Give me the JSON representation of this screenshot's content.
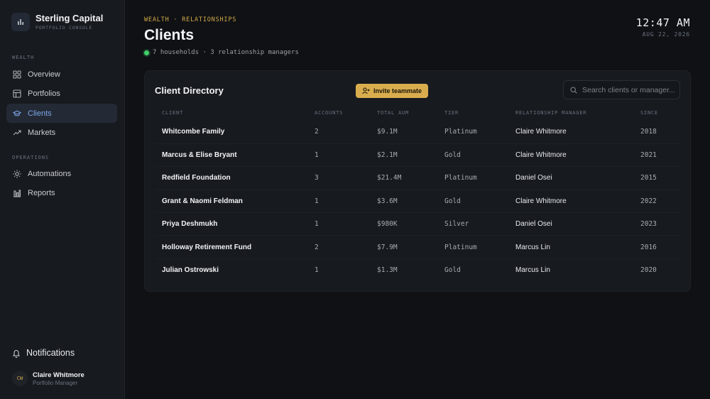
{
  "brand": {
    "name": "Sterling Capital",
    "subtitle": "PORTFOLIO CONSOLE"
  },
  "sidebar": {
    "sections": [
      {
        "label": "WEALTH",
        "items": [
          {
            "label": "Overview",
            "icon": "grid-icon"
          },
          {
            "label": "Portfolios",
            "icon": "table-icon"
          },
          {
            "label": "Clients",
            "icon": "graduation-cap-icon",
            "active": true
          },
          {
            "label": "Markets",
            "icon": "trending-up-icon"
          }
        ]
      },
      {
        "label": "OPERATIONS",
        "items": [
          {
            "label": "Automations",
            "icon": "sun-icon"
          },
          {
            "label": "Reports",
            "icon": "bar-chart-icon"
          }
        ]
      }
    ],
    "notifications_label": "Notifications",
    "user": {
      "initials": "CW",
      "name": "Claire Whitmore",
      "role": "Portfolio Manager"
    }
  },
  "header": {
    "breadcrumb": "WEALTH · RELATIONSHIPS",
    "title": "Clients",
    "summary": "7 households · 3 relationship managers",
    "status_color": "#3ecf6b",
    "time": "12:47 AM",
    "date": "AUG 22, 2026"
  },
  "directory": {
    "title": "Client Directory",
    "invite_label": "Invite teammate",
    "search_placeholder": "Search clients or manager...",
    "accent_color": "#d9ad4e",
    "columns": [
      "CLIENT",
      "ACCOUNTS",
      "TOTAL AUM",
      "TIER",
      "RELATIONSHIP MANAGER",
      "SINCE"
    ],
    "rows": [
      {
        "client": "Whitcombe Family",
        "accounts": "2",
        "aum": "$9.1M",
        "tier": "Platinum",
        "manager": "Claire Whitmore",
        "since": "2018"
      },
      {
        "client": "Marcus & Elise Bryant",
        "accounts": "1",
        "aum": "$2.1M",
        "tier": "Gold",
        "manager": "Claire Whitmore",
        "since": "2021"
      },
      {
        "client": "Redfield Foundation",
        "accounts": "3",
        "aum": "$21.4M",
        "tier": "Platinum",
        "manager": "Daniel Osei",
        "since": "2015"
      },
      {
        "client": "Grant & Naomi Feldman",
        "accounts": "1",
        "aum": "$3.6M",
        "tier": "Gold",
        "manager": "Claire Whitmore",
        "since": "2022"
      },
      {
        "client": "Priya Deshmukh",
        "accounts": "1",
        "aum": "$980K",
        "tier": "Silver",
        "manager": "Daniel Osei",
        "since": "2023"
      },
      {
        "client": "Holloway Retirement Fund",
        "accounts": "2",
        "aum": "$7.9M",
        "tier": "Platinum",
        "manager": "Marcus Lin",
        "since": "2016"
      },
      {
        "client": "Julian Ostrowski",
        "accounts": "1",
        "aum": "$1.3M",
        "tier": "Gold",
        "manager": "Marcus Lin",
        "since": "2020"
      }
    ]
  }
}
